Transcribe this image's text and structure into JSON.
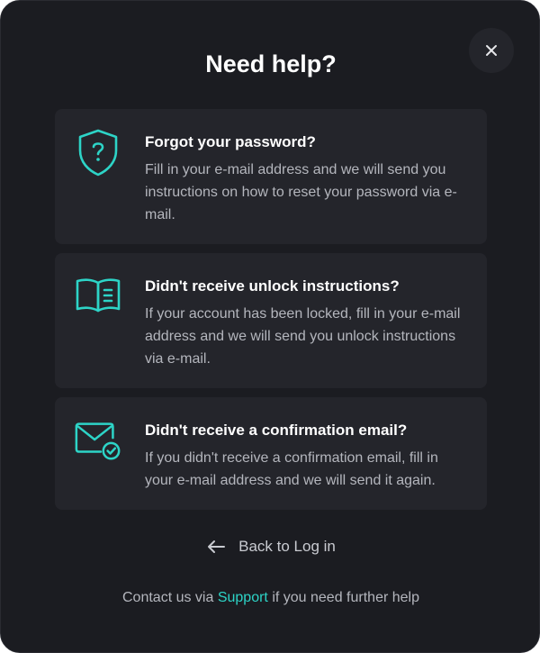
{
  "dialog": {
    "title": "Need help?",
    "close_icon": "close-icon",
    "accent_color": "#2dd4c7",
    "background_color": "#1b1c21"
  },
  "options": [
    {
      "icon": "shield-question-icon",
      "title": "Forgot your password?",
      "description": "Fill in your e-mail address and we will send you instructions on how to reset your password via e-mail."
    },
    {
      "icon": "book-open-icon",
      "title": "Didn't receive unlock instructions?",
      "description": "If your account has been locked, fill in your e-mail address and we will send you unlock instructions via e-mail."
    },
    {
      "icon": "mail-check-icon",
      "title": "Didn't receive a confirmation email?",
      "description": "If you didn't receive a confirmation email, fill in your e-mail address and we will send it again."
    }
  ],
  "back_link": {
    "icon": "arrow-left-icon",
    "label": "Back to Log in"
  },
  "contact": {
    "prefix": "Contact us via ",
    "link_label": "Support",
    "suffix": " if you need further help"
  }
}
